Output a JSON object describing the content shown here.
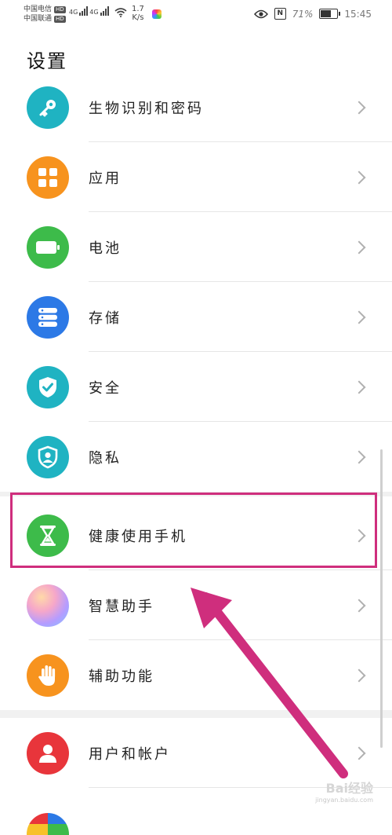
{
  "status_bar": {
    "carrier_1": "中国电信",
    "carrier_2": "中国联通",
    "hd": "HD",
    "network": "4G",
    "speed_value": "1.7",
    "speed_unit": "K/s",
    "battery_percent": "71%",
    "battery_level": 0.71,
    "time": "15:45"
  },
  "page": {
    "title": "设置"
  },
  "settings": {
    "items": [
      {
        "label": "生物识别和密码",
        "icon": "key-icon",
        "color": "#1fb3c2"
      },
      {
        "label": "应用",
        "icon": "apps-grid-icon",
        "color": "#f7931e"
      },
      {
        "label": "电池",
        "icon": "battery-icon",
        "color": "#3dbb4a"
      },
      {
        "label": "存储",
        "icon": "storage-icon",
        "color": "#2c79e6"
      },
      {
        "label": "安全",
        "icon": "shield-check-icon",
        "color": "#1fb3c2"
      },
      {
        "label": "隐私",
        "icon": "privacy-icon",
        "color": "#1fb3c2"
      },
      {
        "label": "健康使用手机",
        "icon": "hourglass-icon",
        "color": "#3dbb4a"
      },
      {
        "label": "智慧助手",
        "icon": "assistant-icon",
        "color": "#c7a6ff"
      },
      {
        "label": "辅助功能",
        "icon": "hand-icon",
        "color": "#f7931e"
      },
      {
        "label": "用户和帐户",
        "icon": "user-icon",
        "color": "#e8353b"
      }
    ]
  },
  "annotation": {
    "highlight_color": "#cf2e7d"
  },
  "watermark": {
    "brand": "Bai经验",
    "url": "jingyan.baidu.com"
  }
}
